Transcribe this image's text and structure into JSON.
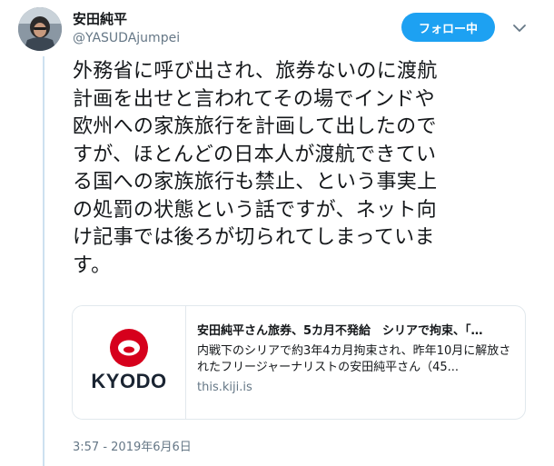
{
  "author": {
    "display_name": "安田純平",
    "handle": "@YASUDAjumpei"
  },
  "follow_button": {
    "label": "フォロー中"
  },
  "icons": {
    "avatar": "user-avatar",
    "more": "chevron-down-icon",
    "card_logo": "kyodo-logo"
  },
  "tweet": {
    "text": "外務省に呼び出され、旅券ないのに渡航\n計画を出せと言われてその場でインドや\n欧州への家族旅行を計画して出したので\nすが、ほとんどの日本人が渡航できてい\nる国への家族旅行も禁止、という事実上\nの処罰の状態という話ですが、ネット向\nけ記事では後ろが切られてしまっていま\nす。",
    "timestamp": "3:57 - 2019年6月6日"
  },
  "card": {
    "logo_text": "KYODO",
    "title": "安田純平さん旅券、5カ月不発給　シリアで拘束、「…",
    "description": "内戦下のシリアで約3年4カ月拘束され、昨年10月に解放されたフリージャーナリストの安田純平さん（45...",
    "domain": "this.kiji.is"
  },
  "colors": {
    "accent": "#1da1f2",
    "thread_line": "#cde1f0",
    "muted_text": "#657786",
    "kyodo_red": "#d6001c",
    "kyodo_navy": "#1a2432"
  }
}
